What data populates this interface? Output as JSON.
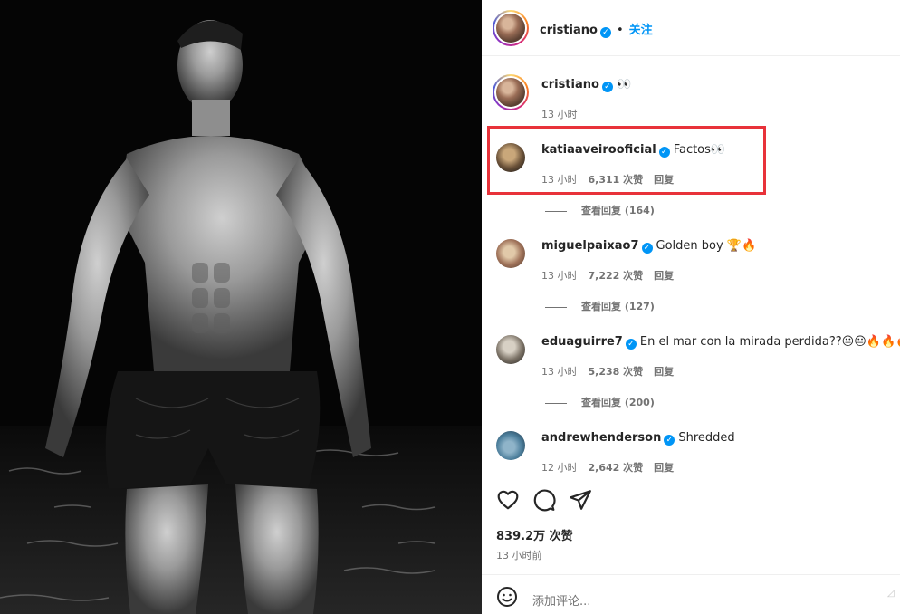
{
  "post": {
    "author": "cristiano",
    "follow_label": "关注",
    "caption_text": "👀",
    "caption_time": "13 小时"
  },
  "comments": [
    {
      "username": "katiaaveirooficial",
      "text": "Factos👀",
      "time": "13 小时",
      "likes": "6,311 次赞",
      "reply": "回复",
      "view_replies": "查看回复 (164)"
    },
    {
      "username": "miguelpaixao7",
      "text": "Golden boy 🏆🔥",
      "time": "13 小时",
      "likes": "7,222 次赞",
      "reply": "回复",
      "view_replies": "查看回复 (127)"
    },
    {
      "username": "eduaguirre7",
      "text": "En el mar con la mirada perdida??😐😐🔥🔥🔥",
      "time": "13 小时",
      "likes": "5,238 次赞",
      "reply": "回复",
      "view_replies": "查看回复 (200)"
    },
    {
      "username": "andrewhenderson",
      "text": "Shredded",
      "time": "12 小时",
      "likes": "2,642 次赞",
      "reply": "回复"
    }
  ],
  "actions": {
    "likes_total": "839.2万 次赞",
    "posted_time": "13 小时前"
  },
  "add_comment": {
    "placeholder": "添加评论..."
  },
  "icons": [
    "heart-icon",
    "comment-icon",
    "share-icon",
    "emoji-icon",
    "verified-badge-icon"
  ],
  "colors": {
    "accent": "#0095f6",
    "highlight": "#e8323a",
    "muted": "#737373"
  }
}
